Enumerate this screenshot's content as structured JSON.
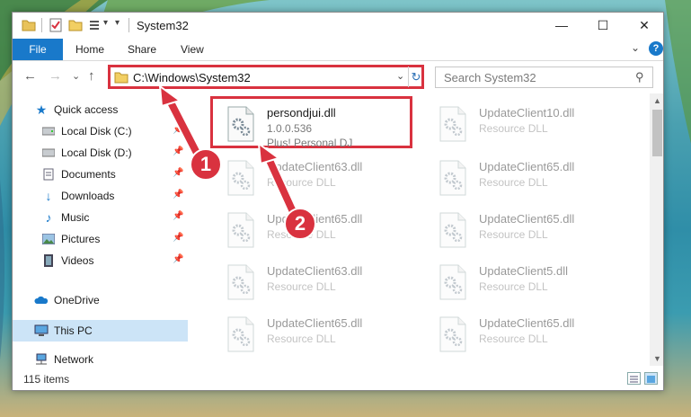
{
  "window": {
    "title": "System32",
    "minimize_glyph": "—",
    "maximize_glyph": "☐",
    "close_glyph": "✕"
  },
  "ribbon": {
    "tabs": [
      "File",
      "Home",
      "Share",
      "View"
    ],
    "help_glyph": "?",
    "collapse_glyph": "⌄"
  },
  "nav": {
    "back_glyph": "←",
    "forward_glyph": "→",
    "recent_glyph": "⌄",
    "up_glyph": "↑"
  },
  "address": {
    "path": "C:\\Windows\\System32",
    "dropdown_glyph": "⌄",
    "refresh_glyph": "↻"
  },
  "search": {
    "placeholder": "Search System32",
    "icon": "search-icon"
  },
  "sidebar": {
    "items": [
      {
        "label": "Quick access",
        "icon": "star-icon",
        "pinned": false
      },
      {
        "label": "Local Disk (C:)",
        "icon": "drive-icon",
        "pinned": true
      },
      {
        "label": "Local Disk (D:)",
        "icon": "drive-icon",
        "pinned": true
      },
      {
        "label": "Documents",
        "icon": "documents-icon",
        "pinned": true
      },
      {
        "label": "Downloads",
        "icon": "downloads-icon",
        "pinned": true
      },
      {
        "label": "Music",
        "icon": "music-icon",
        "pinned": true
      },
      {
        "label": "Pictures",
        "icon": "pictures-icon",
        "pinned": true
      },
      {
        "label": "Videos",
        "icon": "videos-icon",
        "pinned": true
      },
      {
        "label": "OneDrive",
        "icon": "onedrive-icon",
        "pinned": false
      },
      {
        "label": "This PC",
        "icon": "computer-icon",
        "pinned": false,
        "selected": true
      },
      {
        "label": "Network",
        "icon": "network-icon",
        "pinned": false
      }
    ]
  },
  "files": [
    {
      "name": "persondjui.dll",
      "version": "1.0.0.536",
      "description": "Plus! Personal DJ",
      "highlighted": true
    },
    {
      "name": "UpdateClient10.dll",
      "version": "Resource DLL"
    },
    {
      "name": "UpdateClient63.dll",
      "version": "Resource DLL"
    },
    {
      "name": "UpdateClient65.dll",
      "version": "Resource DLL"
    },
    {
      "name": "UpdateClient65.dll",
      "version": "Resource DLL"
    },
    {
      "name": "UpdateClient65.dll",
      "version": "Resource DLL"
    },
    {
      "name": "UpdateClient63.dll",
      "version": "Resource DLL"
    },
    {
      "name": "UpdateClient5.dll",
      "version": "Resource DLL"
    },
    {
      "name": "UpdateClient65.dll",
      "version": "Resource DLL"
    },
    {
      "name": "UpdateClient65.dll",
      "version": "Resource DLL"
    }
  ],
  "status": {
    "item_count": "115 items"
  },
  "annotations": [
    {
      "number": "1"
    },
    {
      "number": "2"
    }
  ],
  "colors": {
    "accent": "#1979ca",
    "highlight": "#d9323f",
    "selected": "#cce4f7"
  }
}
